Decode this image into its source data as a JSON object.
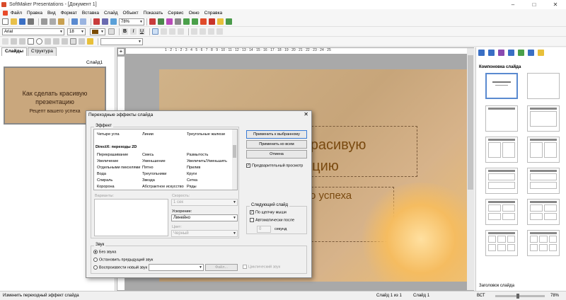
{
  "window": {
    "title": "SoftMaker Presentations - [Документ 1]"
  },
  "menu": [
    "Файл",
    "Правка",
    "Вид",
    "Формат",
    "Вставка",
    "Слайд",
    "Объект",
    "Показать",
    "Сервис",
    "Окно",
    "Справка"
  ],
  "toolbar": {
    "zoom": "78%",
    "font": "Arial",
    "size": "18"
  },
  "left_panel": {
    "tabs": [
      "Слайды",
      "Структура"
    ],
    "slide_label": "Слайд1",
    "thumb_title": "Как сделать красивую презентацию",
    "thumb_subtitle": "Рецепт вашего успеха"
  },
  "ruler": "1 · 2 · 1 · 2 · 3 · 4 · 5 · 6 · 7 · 8 · 9 · 10 · 11 · 12 · 13 · 14 · 15 · 16 · 17 · 18 · 19 · 20 · 21 · 22 · 23 · 24 · 25",
  "slide": {
    "title_visible": "красивую\nацию",
    "subtitle_visible": "о успеха"
  },
  "right_panel": {
    "header": "Компоновка слайда",
    "footer": "Заголовок слайда"
  },
  "dialog": {
    "title": "Переходные эффекты слайда",
    "effect_group": "Эффект",
    "effects_row0": [
      "Четыре угла",
      "Линии",
      "Треугольные жалюзи"
    ],
    "effects_section": "DirectX: переходы 2D",
    "effects_rows": [
      [
        "Перекрашивание",
        "Смесь",
        "Размытость"
      ],
      [
        "Увеличение",
        "Уменьшение",
        "Увеличить/Уменьшить"
      ],
      [
        "Отдельными пикселями",
        "Пятно",
        "Прилив"
      ],
      [
        "Вода",
        "Треугольники",
        "Круги"
      ],
      [
        "Спираль",
        "Звезда",
        "Сетка"
      ],
      [
        "Коророна",
        "Абстрактное искусство",
        "Ряды"
      ]
    ],
    "variants_label": "Варианты:",
    "speed_label": "Скорость:",
    "speed_value": "1 сек",
    "accel_label": "Ускорение:",
    "accel_value": "Линейно",
    "color_label": "Цвет:",
    "color_value": "Черный",
    "buttons": {
      "apply_selected": "Применить к выбранному",
      "apply_all": "Применить ко всем",
      "cancel": "Отмена"
    },
    "preview_label": "Предварительный просмотр",
    "next_slide_group": "Следующий слайд",
    "on_click": "По щелчку мыши",
    "auto_after": "Автоматически после",
    "seconds_value": "0",
    "seconds_label": "секунд",
    "sound_group": "Звук",
    "sound_options": [
      "Без звука",
      "Остановить предыдущий звук",
      "Воспроизвести новый звук"
    ],
    "file_button": "Файл...",
    "loop_label": "Циклический звук"
  },
  "status": {
    "hint": "Изменить переходный эффект слайда",
    "slide_of": "Слайд 1 из 1",
    "slide_name": "Слайд 1",
    "mode": "ВСТ",
    "zoom": "78%"
  }
}
